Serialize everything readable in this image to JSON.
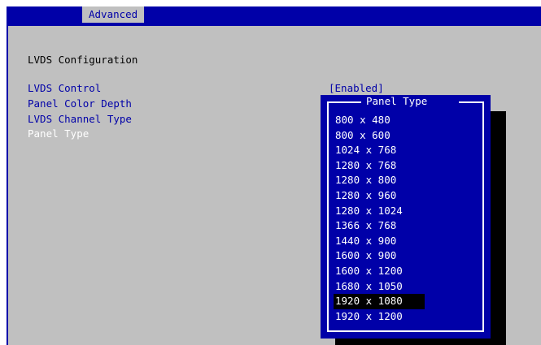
{
  "header": {
    "tab_label": "Advanced"
  },
  "main": {
    "heading": "LVDS Configuration",
    "items": [
      {
        "label": "LVDS Control",
        "value": "[Enabled]"
      },
      {
        "label": "Panel Color Depth"
      },
      {
        "label": "LVDS Channel Type"
      },
      {
        "label": "Panel Type"
      }
    ]
  },
  "popup": {
    "title": "Panel Type",
    "options": [
      "800 x 480",
      "800 x 600",
      "1024 x 768",
      "1280 x 768",
      "1280 x 800",
      "1280 x 960",
      "1280 x 1024",
      "1366 x 768",
      "1440 x 900",
      "1600 x 900",
      "1600 x 1200",
      "1680 x 1050",
      "1920 x 1080",
      "1920 x 1200"
    ],
    "highlighted": "1920 x 1080"
  },
  "colors": {
    "bios_blue": "#0000a8",
    "bios_gray": "#c0c0c0",
    "highlight_bg": "#000000"
  }
}
